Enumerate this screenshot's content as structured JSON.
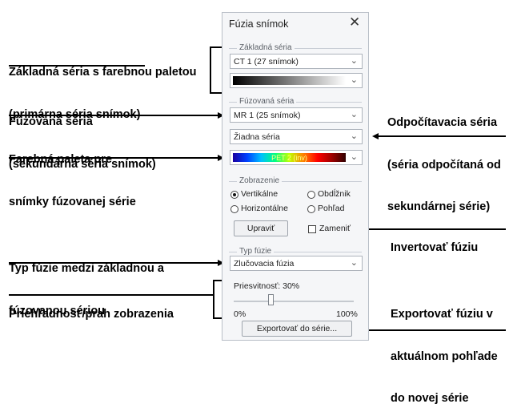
{
  "dialog": {
    "title": "Fúzia snímok",
    "close_label": "✕",
    "base_group": "Základná séria",
    "base_series": "CT 1 (27 snímok)",
    "fused_group": "Fúzovaná séria",
    "fused_series": "MR 1 (25 snímok)",
    "subtract_series": "Žiadna séria",
    "palette_label": "PET 2 (inv)",
    "display_group": "Zobrazenie",
    "radio_vertical": "Vertikálne",
    "radio_rectangle": "Obdĺžnik",
    "radio_horizontal": "Horizontálne",
    "radio_view": "Pohľad",
    "edit_button": "Upraviť",
    "replace_checkbox": "Zameniť",
    "fusion_type_group": "Typ fúzie",
    "fusion_type": "Zlučovacia fúzia",
    "transparency_label": "Priesvitnosť: 30%",
    "transparency_value": 30,
    "slider_min": "0%",
    "slider_max": "100%",
    "export_button": "Exportovať do série..."
  },
  "annotations": {
    "base_series_line1": "Základná séria s farebnou paletou",
    "base_series_line2": "(primárna séria snímok)",
    "fused_series_line1": "Fúzovaná séria",
    "fused_series_line2": "(sekundárna séria snímok)",
    "palette_line1": "Farebná paleta pre",
    "palette_line2": "snímky fúzovanej série",
    "subtract_line1": "Odpočítavacia séria",
    "subtract_line2": "(séria odpočítaná od",
    "subtract_line3": "sekundárnej série)",
    "invert": "Invertovať fúziu",
    "fusion_type_line1": "Typ fúzie medzi základnou a",
    "fusion_type_line2": "fúzovanou sériou",
    "opacity": "Priehľadnosť/prah zobrazenia",
    "export_line1": "Exportovať fúziu v",
    "export_line2": "aktuálnom pohľade",
    "export_line3": "do novej série"
  },
  "colors": {
    "dialog_bg": "#f5f6f8",
    "border": "#b9bfc7"
  }
}
